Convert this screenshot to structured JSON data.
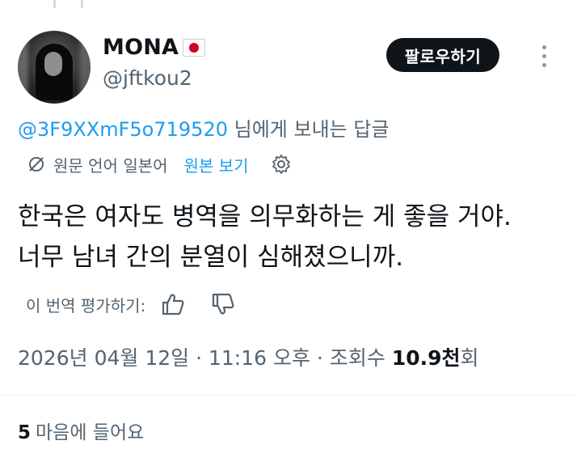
{
  "author": {
    "name": "MONA",
    "handle": "@jftkou2",
    "flag_icon": "japan-flag-icon"
  },
  "follow_label": "팔로우하기",
  "reply_to": {
    "mention": "@3F9XXmF5o719520",
    "suffix": "님에게 보내는 답글"
  },
  "translation": {
    "original_language": "원문 언어 일본어",
    "view_original": "원본 보기"
  },
  "tweet_lines": [
    "한국은 여자도 병역을 의무화하는 게 좋을 거야.",
    "너무 남녀 간의 분열이 심해졌으니까."
  ],
  "rate_label": "이 번역 평가하기:",
  "meta": {
    "date": "2026년 04월 12일",
    "time": "11:16 오후",
    "views_prefix": "조회수",
    "views": "10.9천",
    "views_suffix": "회"
  },
  "likes": {
    "count": "5",
    "label": "마음에 들어요"
  },
  "colors": {
    "accent": "#1d9bf0",
    "text": "#0f1419",
    "secondary": "#536471",
    "button_bg": "#0f1419"
  }
}
